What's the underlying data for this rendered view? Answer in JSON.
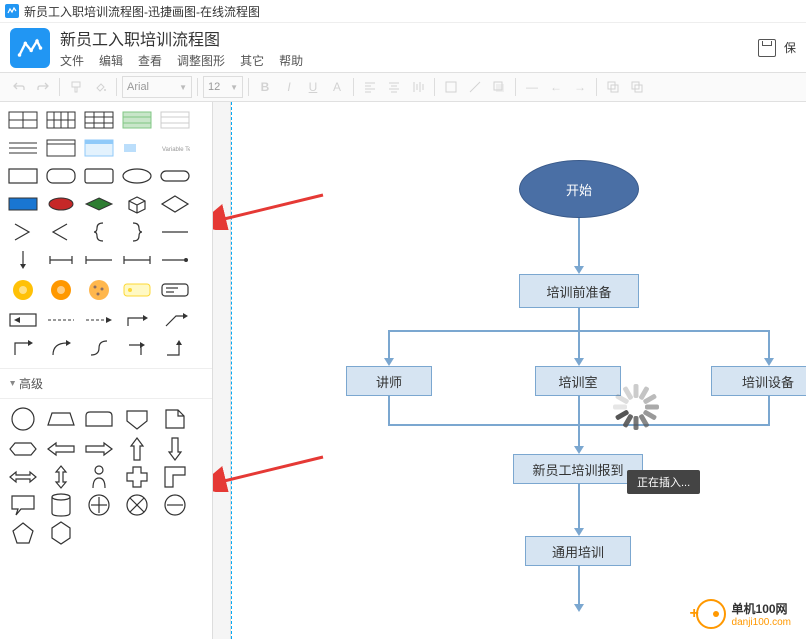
{
  "browser": {
    "tab_title": "新员工入职培训流程图-迅捷画图-在线流程图"
  },
  "app": {
    "title": "新员工入职培训流程图",
    "save_label": "保"
  },
  "menubar": {
    "file": "文件",
    "edit": "编辑",
    "view": "查看",
    "adjust": "调整图形",
    "other": "其它",
    "help": "帮助"
  },
  "toolbar": {
    "font_family": "Arial",
    "font_size": "12"
  },
  "sidebar": {
    "section_advanced": "高级"
  },
  "flowchart": {
    "start": "开始",
    "prep": "培训前准备",
    "lecturer": "讲师",
    "room": "培训室",
    "equipment": "培训设备",
    "checkin": "新员工培训报到",
    "general": "通用培训"
  },
  "tooltip": {
    "inserting": "正在插入..."
  },
  "watermark": {
    "site_name": "单机100网",
    "site_url": "danji100.com"
  }
}
